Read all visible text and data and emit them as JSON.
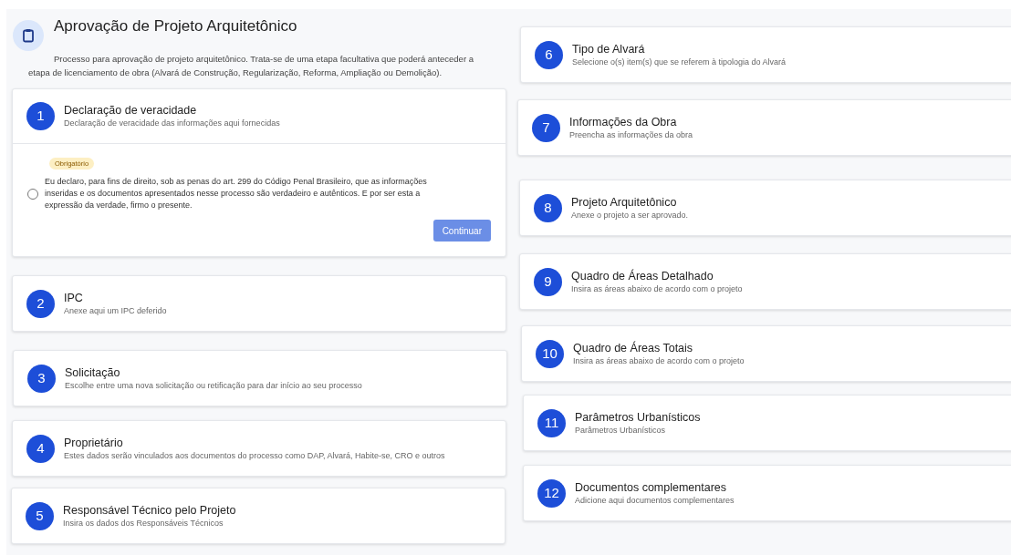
{
  "header": {
    "title": "Aprovação de Projeto Arquitetônico",
    "description": "Processo para aprovação de projeto arquitetônico. Trata-se de uma etapa facultativa que poderá anteceder a etapa de licenciamento de obra (Alvará de Construção, Regularização, Reforma, Ampliação ou Demolição)."
  },
  "steps": [
    {
      "number": "1",
      "title": "Declaração de veracidade",
      "subtitle": "Declaração de veracidade das informações aqui fornecidas",
      "expanded": true,
      "body": {
        "badge": "Obrigatório",
        "declaration": "Eu declaro, para fins de direito, sob as penas do art. 299 do Código Penal Brasileiro, que as informações inseridas e os documentos apresentados nesse processo são verdadeiro e autênticos. E por ser esta a expressão da verdade, firmo o presente.",
        "checked": false,
        "button": {
          "label": "Continuar",
          "disabled": true
        }
      }
    },
    {
      "number": "2",
      "title": "IPC",
      "subtitle": "Anexe aqui um IPC deferido",
      "expanded": false
    },
    {
      "number": "3",
      "title": "Solicitação",
      "subtitle": "Escolhe entre uma nova solicitação ou retificação para dar início ao seu processo",
      "expanded": false
    },
    {
      "number": "4",
      "title": "Proprietário",
      "subtitle": "Estes dados serão vinculados aos documentos do processo como DAP, Alvará, Habite-se, CRO e outros",
      "expanded": false
    },
    {
      "number": "5",
      "title": "Responsável Técnico pelo Projeto",
      "subtitle": "Insira os dados dos Responsáveis Técnicos",
      "expanded": false
    },
    {
      "number": "6",
      "title": "Tipo de Alvará",
      "subtitle": "Selecione o(s) item(s) que se referem à tipologia do Alvará",
      "expanded": false
    },
    {
      "number": "7",
      "title": "Informações da Obra",
      "subtitle": "Preencha as informações da obra",
      "expanded": false
    },
    {
      "number": "8",
      "title": "Projeto Arquitetônico",
      "subtitle": "Anexe o projeto a ser aprovado.",
      "expanded": false
    },
    {
      "number": "9",
      "title": "Quadro de Áreas Detalhado",
      "subtitle": "Insira as áreas abaixo de acordo com o projeto",
      "expanded": false
    },
    {
      "number": "10",
      "title": "Quadro de Áreas Totais",
      "subtitle": "Insira as áreas abaixo de acordo com o projeto",
      "expanded": false
    },
    {
      "number": "11",
      "title": "Parâmetros Urbanísticos",
      "subtitle": "Parâmetros Urbanísticos",
      "expanded": false
    },
    {
      "number": "12",
      "title": "Documentos complementares",
      "subtitle": "Adicione aqui documentos complementares",
      "expanded": false
    }
  ]
}
